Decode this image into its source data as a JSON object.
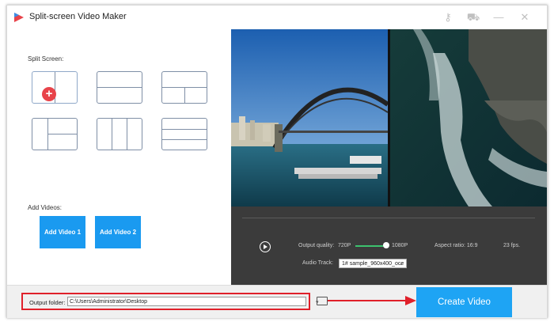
{
  "window": {
    "title": "Split-screen Video Maker"
  },
  "titlebar_icons": [
    "key-icon",
    "cart-icon",
    "minimize-icon",
    "close-icon"
  ],
  "left_panel": {
    "split_screen_label": "Split Screen:",
    "add_videos_label": "Add Videos:",
    "add_video_1": "Add Video 1",
    "add_video_2": "Add Video 2"
  },
  "controls": {
    "output_quality_label": "Output quality:",
    "quality_min": "720P",
    "quality_max": "1080P",
    "quality_value": 1.0,
    "aspect_ratio": "Aspect ratio: 16:9",
    "fps": "23 fps.",
    "audio_track_label": "Audio Track:",
    "audio_track_value": "1# sample_960x400_oce"
  },
  "bottom": {
    "output_folder_label": "Output folder:",
    "output_folder_value": "C:\\Users\\Administrator\\Desktop",
    "create_button": "Create Video"
  },
  "colors": {
    "accent": "#1ea4f4",
    "highlight": "#e0202a",
    "plus": "#e8434a"
  }
}
